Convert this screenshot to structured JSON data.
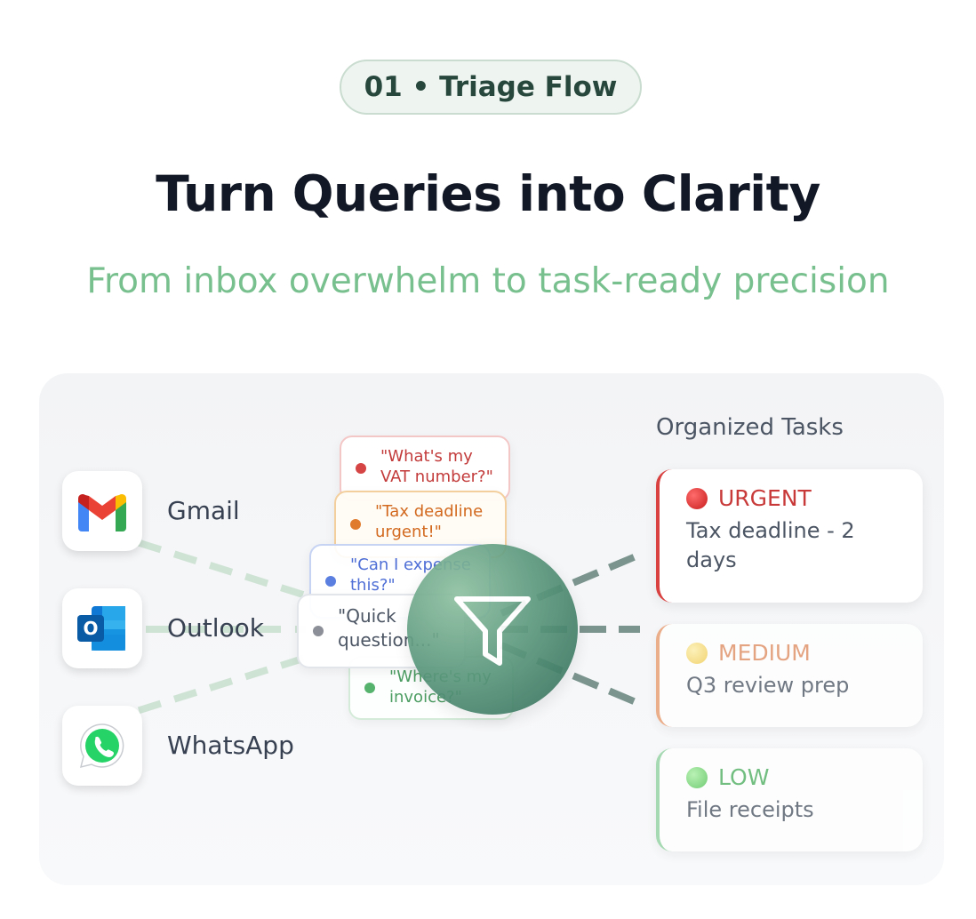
{
  "header": {
    "badge": "01 • Triage Flow",
    "title": "Turn Queries into Clarity",
    "subtitle": "From inbox overwhelm to task-ready precision"
  },
  "sources": [
    {
      "name": "Gmail",
      "icon": "gmail-icon"
    },
    {
      "name": "Outlook",
      "icon": "outlook-icon"
    },
    {
      "name": "WhatsApp",
      "icon": "whatsapp-icon"
    }
  ],
  "messages": [
    {
      "text": "\"What's my VAT number?\"",
      "color": "#d64545"
    },
    {
      "text": "\"Tax deadline urgent!\"",
      "color": "#e07b2e"
    },
    {
      "text": "\"Can I expense this?\"",
      "color": "#5b7fe0"
    },
    {
      "text": "\"Quick question...\"",
      "color": "#6b7280"
    },
    {
      "text": "\"Where's my invoice?\"",
      "color": "#3aa857"
    }
  ],
  "filter": {
    "icon": "filter-icon"
  },
  "tasks": {
    "heading": "Organized Tasks",
    "items": [
      {
        "priority": "URGENT",
        "desc": "Tax deadline - 2 days",
        "color": "#d94141",
        "dot": "#e03a3a"
      },
      {
        "priority": "MEDIUM",
        "desc": "Q3 review prep",
        "color": "#e99a6c",
        "dot": "#f2d36b"
      },
      {
        "priority": "LOW",
        "desc": "File receipts",
        "color": "#8fd19e",
        "dot": "#6ccf6f"
      }
    ]
  }
}
